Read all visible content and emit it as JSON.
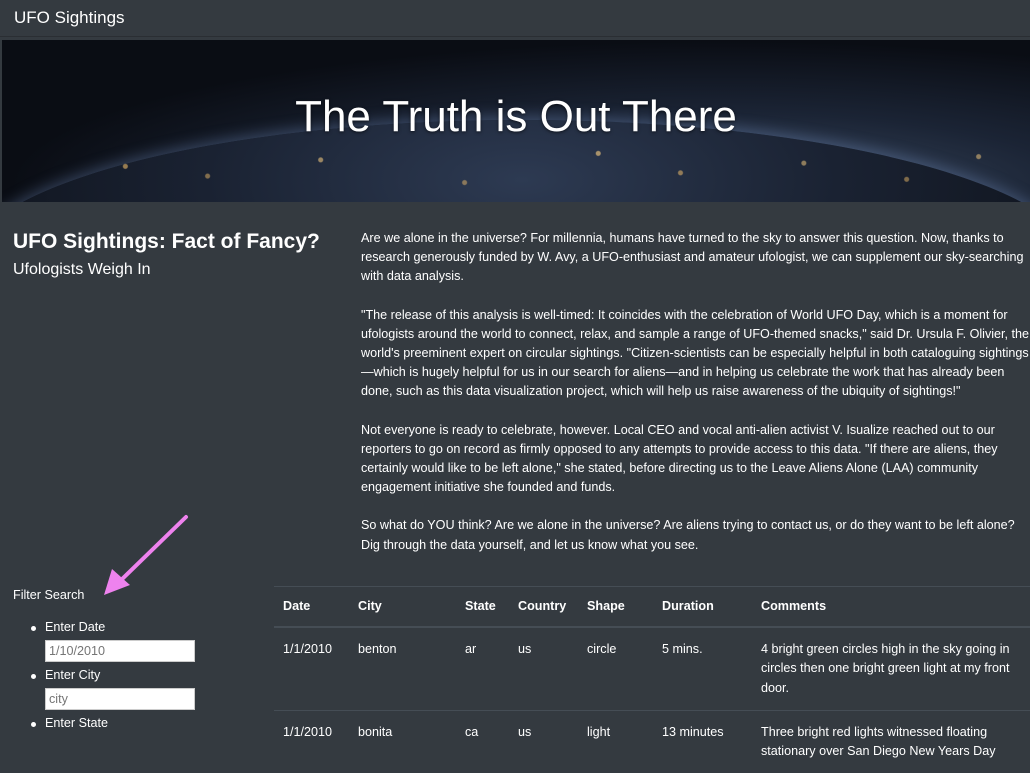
{
  "navbar": {
    "brand": "UFO Sightings"
  },
  "hero": {
    "title": "The Truth is Out There"
  },
  "intro": {
    "title": "UFO Sightings: Fact of Fancy?",
    "subtitle": "Ufologists Weigh In"
  },
  "article": {
    "paragraphs": [
      "Are we alone in the universe? For millennia, humans have turned to the sky to answer this question. Now, thanks to research generously funded by W. Avy, a UFO-enthusiast and amateur ufologist, we can supplement our sky-searching with data analysis.",
      "\"The release of this analysis is well-timed: It coincides with the celebration of World UFO Day, which is a moment for ufologists around the world to connect, relax, and sample a range of UFO-themed snacks,\" said Dr. Ursula F. Olivier, the world's preeminent expert on circular sightings. \"Citizen-scientists can be especially helpful in both cataloguing sightings—which is hugely helpful for us in our search for aliens—and in helping us celebrate the work that has already been done, such as this data visualization project, which will help us raise awareness of the ubiquity of sightings!\"",
      "Not everyone is ready to celebrate, however. Local CEO and vocal anti-alien activist V. Isualize reached out to our reporters to go on record as firmly opposed to any attempts to provide access to this data. \"If there are aliens, they certainly would like to be left alone,\" she stated, before directing us to the Leave Aliens Alone (LAA) community engagement initiative she founded and funds.",
      "So what do YOU think? Are we alone in the universe? Are aliens trying to contact us, or do they want to be left alone? Dig through the data yourself, and let us know what you see."
    ]
  },
  "filters": {
    "label": "Filter Search",
    "items": [
      {
        "label": "Enter Date",
        "placeholder": "1/10/2010"
      },
      {
        "label": "Enter City",
        "placeholder": "city"
      },
      {
        "label": "Enter State",
        "placeholder": ""
      }
    ]
  },
  "table": {
    "headers": [
      "Date",
      "City",
      "State",
      "Country",
      "Shape",
      "Duration",
      "Comments"
    ],
    "rows": [
      [
        "1/1/2010",
        "benton",
        "ar",
        "us",
        "circle",
        "5 mins.",
        "4 bright green circles high in the sky going in circles then one bright green light at my front door."
      ],
      [
        "1/1/2010",
        "bonita",
        "ca",
        "us",
        "light",
        "13 minutes",
        "Three bright red lights witnessed floating stationary over San Diego New Years Day"
      ]
    ]
  },
  "colors": {
    "background": "#343a40",
    "arrow": "#ee82ee"
  }
}
